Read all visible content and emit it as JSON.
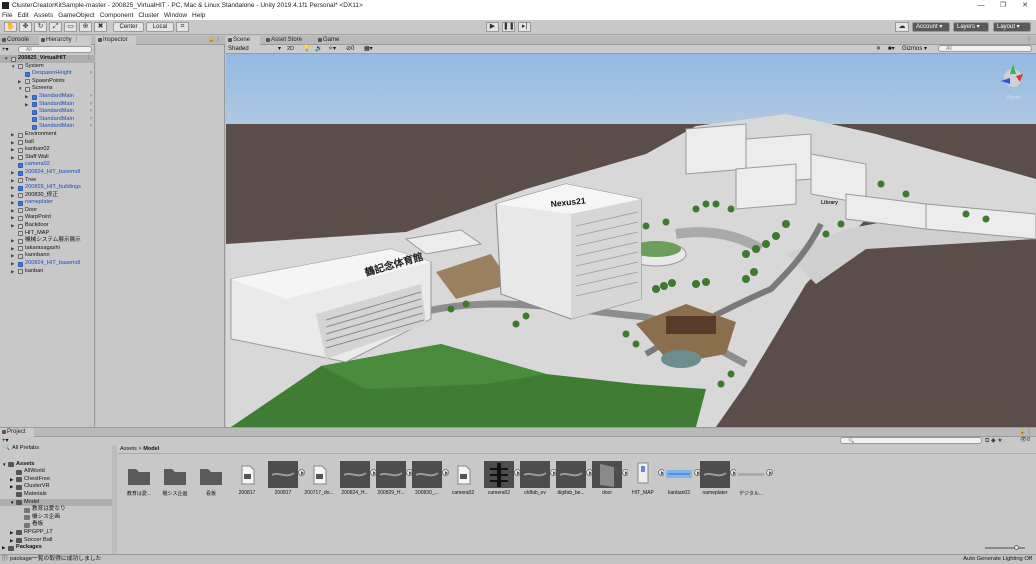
{
  "window": {
    "title": "ClusterCreatorKitSample-master - 200825_VirtualHIT - PC, Mac & Linux Standalone - Unity 2019.4.1f1 Personal* <DX11>",
    "controls": [
      "—",
      "❐",
      "✕"
    ]
  },
  "menu": [
    "File",
    "Edit",
    "Assets",
    "GameObject",
    "Component",
    "Cluster",
    "Window",
    "Help"
  ],
  "toolbar": {
    "pivot": "Center",
    "space": "Local",
    "account": "Account",
    "layers": "Layers",
    "layout": "Layout"
  },
  "panels": {
    "console": "Console",
    "hierarchy": "Hierarchy",
    "inspector": "Inspector",
    "scene": "Scene",
    "asset_store": "Asset Store",
    "game": "Game",
    "project": "Project"
  },
  "hierarchy": {
    "search_placeholder": "All",
    "items": [
      {
        "label": "200825_VirtualHIT",
        "depth": 0,
        "icon": "scene",
        "arrow": "down",
        "selected": true
      },
      {
        "label": "System",
        "depth": 1,
        "icon": "gameobject",
        "arrow": "down"
      },
      {
        "label": "DespawnHeight",
        "depth": 2,
        "icon": "prefab",
        "blue": true,
        "chev": true
      },
      {
        "label": "SpawnPoints",
        "depth": 2,
        "icon": "gameobject",
        "arrow": "right"
      },
      {
        "label": "Screens",
        "depth": 2,
        "icon": "gameobject",
        "arrow": "down"
      },
      {
        "label": "StandardMain",
        "depth": 3,
        "icon": "prefab",
        "blue": true,
        "arrow": "right",
        "chev": true
      },
      {
        "label": "StandardMain",
        "depth": 3,
        "icon": "prefab",
        "blue": true,
        "arrow": "right",
        "chev": true
      },
      {
        "label": "StandardMain",
        "depth": 3,
        "icon": "prefab",
        "blue": true,
        "chev": true
      },
      {
        "label": "StandardMain",
        "depth": 3,
        "icon": "prefab",
        "blue": true,
        "chev": true
      },
      {
        "label": "StandardMain",
        "depth": 3,
        "icon": "prefab",
        "blue": true,
        "chev": true
      },
      {
        "label": "Environment",
        "depth": 1,
        "icon": "gameobject",
        "arrow": "right"
      },
      {
        "label": "ball",
        "depth": 1,
        "icon": "gameobject",
        "arrow": "right"
      },
      {
        "label": "kanban02",
        "depth": 1,
        "icon": "gameobject",
        "arrow": "right"
      },
      {
        "label": "Staff Wall",
        "depth": 1,
        "icon": "gameobject",
        "arrow": "right"
      },
      {
        "label": "camera02",
        "depth": 1,
        "icon": "prefab",
        "blue": true
      },
      {
        "label": "200824_HIT_basemdl",
        "depth": 1,
        "icon": "prefab",
        "blue": true,
        "arrow": "right"
      },
      {
        "label": "Tree",
        "depth": 1,
        "icon": "gameobject",
        "arrow": "right"
      },
      {
        "label": "200829_HIT_buildings",
        "depth": 1,
        "icon": "prefab",
        "blue": true,
        "arrow": "right"
      },
      {
        "label": "200830_修正",
        "depth": 1,
        "icon": "gameobject",
        "arrow": "right"
      },
      {
        "label": "nameplater",
        "depth": 1,
        "icon": "prefab",
        "blue": true,
        "arrow": "right"
      },
      {
        "label": "Door",
        "depth": 1,
        "icon": "gameobject",
        "arrow": "right"
      },
      {
        "label": "WarpPoint",
        "depth": 1,
        "icon": "gameobject",
        "arrow": "right"
      },
      {
        "label": "Backdoor",
        "depth": 1,
        "icon": "gameobject",
        "arrow": "right"
      },
      {
        "label": "HIT_MAP",
        "depth": 1,
        "icon": "gameobject"
      },
      {
        "label": "機械システム展示展示",
        "depth": 1,
        "icon": "gameobject",
        "arrow": "right"
      },
      {
        "label": "takarasagashi",
        "depth": 1,
        "icon": "gameobject",
        "arrow": "right"
      },
      {
        "label": "kannbann",
        "depth": 1,
        "icon": "gameobject",
        "arrow": "right"
      },
      {
        "label": "200824_HIT_basemdl",
        "depth": 1,
        "icon": "prefab",
        "blue": true,
        "arrow": "right"
      },
      {
        "label": "kanban",
        "depth": 1,
        "icon": "gameobject",
        "arrow": "right"
      }
    ]
  },
  "scene": {
    "shading_mode": "Shaded",
    "dim_mode": "2D",
    "gizmos": "Gizmos",
    "search_placeholder": "All",
    "hidden_count": "0",
    "persp_label": "Persp",
    "signs": {
      "nexus": "Nexus21",
      "gym": "鶴記念体育館",
      "library": "Library"
    }
  },
  "project": {
    "favorites": "All Prefabs",
    "tree": [
      {
        "label": "Assets",
        "depth": 0,
        "bold": true,
        "arrow": "down"
      },
      {
        "label": "AllWorld",
        "depth": 1,
        "arrow": ""
      },
      {
        "label": "ChestFree",
        "depth": 1,
        "arrow": "right"
      },
      {
        "label": "ClusterVR",
        "depth": 1,
        "arrow": "right"
      },
      {
        "label": "Materials",
        "depth": 1,
        "arrow": ""
      },
      {
        "label": "Model",
        "depth": 1,
        "arrow": "down",
        "selected": true
      },
      {
        "label": "教育は愛なり",
        "depth": 2,
        "arrow": ""
      },
      {
        "label": "機シス企画",
        "depth": 2,
        "arrow": ""
      },
      {
        "label": "看板",
        "depth": 2,
        "arrow": ""
      },
      {
        "label": "RPGPP_LT",
        "depth": 1,
        "arrow": "right"
      },
      {
        "label": "Soccer Ball",
        "depth": 1,
        "arrow": "right"
      },
      {
        "label": "Packages",
        "depth": 0,
        "bold": true,
        "arrow": "right"
      }
    ],
    "breadcrumb": [
      "Assets",
      "Model"
    ],
    "search_placeholder": "",
    "item_count": "8",
    "assets": [
      {
        "label": "教育は愛...",
        "kind": "folder"
      },
      {
        "label": "機シス企画",
        "kind": "folder"
      },
      {
        "label": "看板",
        "kind": "folder"
      },
      {
        "label": "200817",
        "kind": "file"
      },
      {
        "label": "200817",
        "kind": "model"
      },
      {
        "label": "200717_do...",
        "kind": "file"
      },
      {
        "label": "200824_H...",
        "kind": "model"
      },
      {
        "label": "200829_H...",
        "kind": "model"
      },
      {
        "label": "200830_...",
        "kind": "model"
      },
      {
        "label": "camera02",
        "kind": "file"
      },
      {
        "label": "camera02",
        "kind": "model-tree"
      },
      {
        "label": "oldfab_ev",
        "kind": "model"
      },
      {
        "label": "digifab_be...",
        "kind": "model"
      },
      {
        "label": "door",
        "kind": "model-door"
      },
      {
        "label": "HIT_MAP",
        "kind": "model-map"
      },
      {
        "label": "kanban02",
        "kind": "model-kanban"
      },
      {
        "label": "nameplater",
        "kind": "model"
      },
      {
        "label": "デジタル...",
        "kind": "model-thin"
      }
    ]
  },
  "status": {
    "message": "package一覧の取得に成功しました",
    "lighting": "Auto Generate Lighting Off"
  },
  "colors": {
    "panel": "#c8c8c8",
    "sky": "#a9c3dd",
    "ground": "#5a4c48",
    "grass": "#3f7d35"
  }
}
